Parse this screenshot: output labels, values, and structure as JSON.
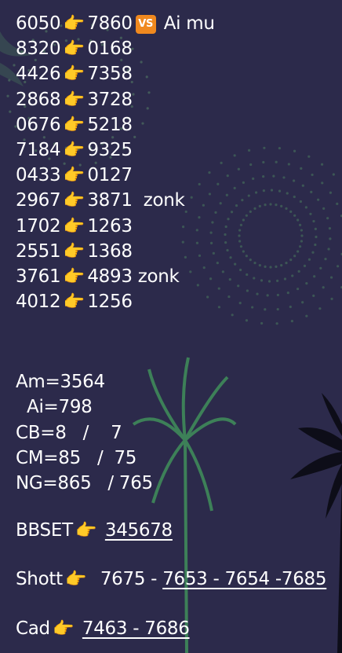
{
  "theme": {
    "background": "#2c2a4b",
    "text": "#ffffff",
    "vs_badge": "#f0891f",
    "hand_icon": "backhand-index-pointing-right"
  },
  "header": {
    "a": "6050",
    "b": "7860",
    "vs": "VS",
    "label": "Ai mu"
  },
  "pairs": [
    {
      "a": "8320",
      "b": "0168",
      "note": ""
    },
    {
      "a": "4426",
      "b": "7358",
      "note": ""
    },
    {
      "a": "2868",
      "b": "3728",
      "note": ""
    },
    {
      "a": "0676",
      "b": "5218",
      "note": ""
    },
    {
      "a": "7184",
      "b": "9325",
      "note": ""
    },
    {
      "a": "0433",
      "b": "0127",
      "note": ""
    },
    {
      "a": "2967",
      "b": "3871",
      "note": "  zonk"
    },
    {
      "a": "1702",
      "b": "1263",
      "note": ""
    },
    {
      "a": "2551",
      "b": "1368",
      "note": ""
    },
    {
      "a": "3761",
      "b": "4893",
      "note": " zonk"
    },
    {
      "a": "4012",
      "b": "1256",
      "note": ""
    }
  ],
  "stats": {
    "am": "Am=3564",
    "ai": "  Ai=798",
    "cb": "CB=8   /    7",
    "cm": "CM=85   /  75",
    "ng": "NG=865   / 765"
  },
  "bbset": {
    "label": "BBSET",
    "value": "345678"
  },
  "shott": {
    "label": "Shott",
    "plain": "  7675 - ",
    "underlined": "7653 - 7654 -7685"
  },
  "cad": {
    "label": "Cad",
    "value": "7463 - 7686"
  }
}
